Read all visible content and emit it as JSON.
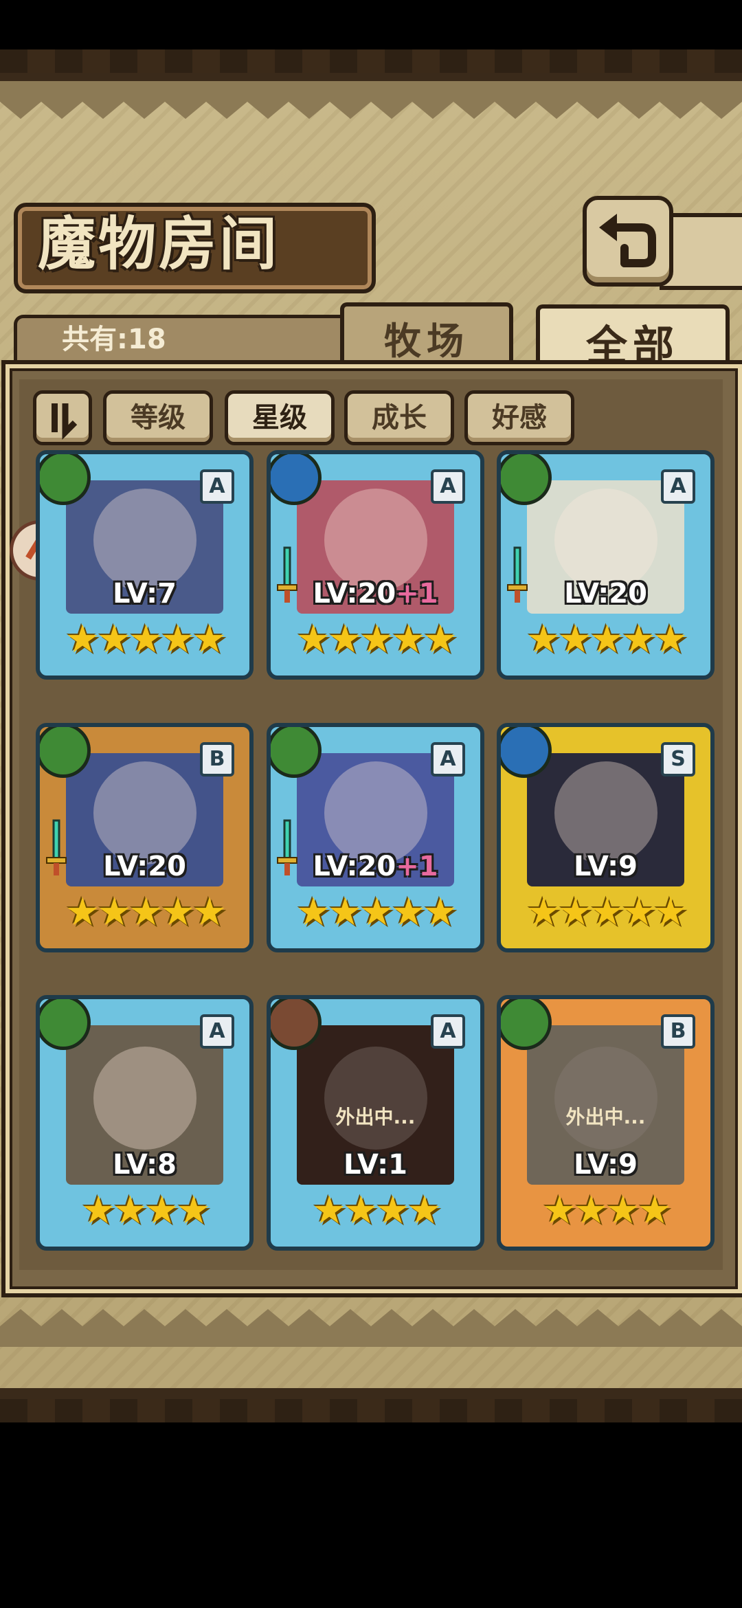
{
  "header": {
    "title": "魔物房间",
    "back_icon": "return-arrow-icon"
  },
  "summary": {
    "count_label": "共有:18"
  },
  "tabs": [
    {
      "label": "牧场",
      "selected": false
    },
    {
      "label": "全部",
      "selected": true
    }
  ],
  "filters": {
    "sort_icon": "sort-toggle-icon",
    "buttons": [
      {
        "label": "等级",
        "selected": false
      },
      {
        "label": "星级",
        "selected": true
      },
      {
        "label": "成长",
        "selected": false
      },
      {
        "label": "好感",
        "selected": false
      }
    ]
  },
  "side_button_icon": "collapse-arrow-icon",
  "colors": {
    "grass": "#3f8a35",
    "water": "#2a6fb5",
    "earth": "#7a4a33",
    "frame_blue": "#6fc3e0",
    "frame_bronze": "#c98a3a",
    "frame_gold": "#e6c22a",
    "frame_orange": "#e89442",
    "star": "#f5c518"
  },
  "monsters": [
    {
      "element": "grass",
      "rank": "A",
      "level": "LV:7",
      "bonus": "",
      "stars": "★★★★★",
      "equipped": false,
      "away": ""
    },
    {
      "element": "water",
      "rank": "A",
      "level": "LV:20",
      "bonus": "+1",
      "stars": "★★★★★",
      "equipped": true,
      "away": ""
    },
    {
      "element": "grass",
      "rank": "A",
      "level": "LV:20",
      "bonus": "",
      "stars": "★★★★★",
      "equipped": true,
      "away": ""
    },
    {
      "element": "grass",
      "rank": "B",
      "level": "LV:20",
      "bonus": "",
      "stars": "★★★★★",
      "equipped": true,
      "away": ""
    },
    {
      "element": "grass",
      "rank": "A",
      "level": "LV:20",
      "bonus": "+1",
      "stars": "★★★★★",
      "equipped": true,
      "away": ""
    },
    {
      "element": "water",
      "rank": "S",
      "level": "LV:9",
      "bonus": "",
      "stars": "★★★★★",
      "equipped": false,
      "away": ""
    },
    {
      "element": "grass",
      "rank": "A",
      "level": "LV:8",
      "bonus": "",
      "stars": "★★★★",
      "equipped": false,
      "away": ""
    },
    {
      "element": "earth",
      "rank": "A",
      "level": "LV:1",
      "bonus": "",
      "stars": "★★★★",
      "equipped": false,
      "away": "外出中..."
    },
    {
      "element": "grass",
      "rank": "B",
      "level": "LV:9",
      "bonus": "",
      "stars": "★★★★",
      "equipped": false,
      "away": "外出中..."
    }
  ]
}
